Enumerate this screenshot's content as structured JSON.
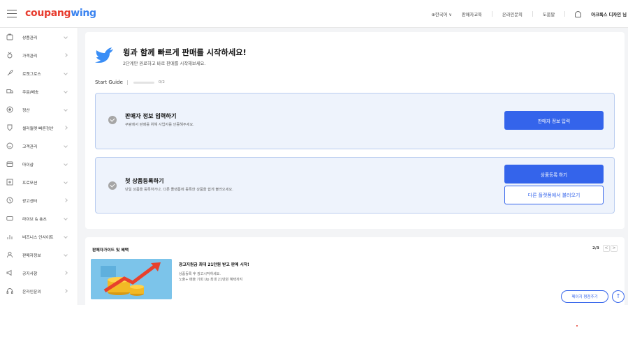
{
  "brand": {
    "part1": "coupang",
    "part2": "wing",
    "color1": "#e73c2f",
    "color2": "#3a83f0"
  },
  "topbar": {
    "language": "⊕한국어 ∨",
    "links": [
      "판매자교육",
      "온라인문의",
      "도움말"
    ],
    "user": "아크록스 디자인 님"
  },
  "sidebar": {
    "items": [
      {
        "label": "상품관리",
        "icon": "product-icon",
        "chevron": "down"
      },
      {
        "label": "가격관리",
        "icon": "price-icon",
        "chevron": "right"
      },
      {
        "label": "로켓그로스",
        "icon": "rocket-icon",
        "chevron": "down"
      },
      {
        "label": "주문/배송",
        "icon": "truck-icon",
        "chevron": "down"
      },
      {
        "label": "정산",
        "icon": "coin-icon",
        "chevron": "down"
      },
      {
        "label": "셀러월렛·빠른정산",
        "icon": "wallet-icon",
        "chevron": "right"
      },
      {
        "label": "고객관리",
        "icon": "customer-icon",
        "chevron": "down"
      },
      {
        "label": "마이샵",
        "icon": "shop-icon",
        "chevron": "down"
      },
      {
        "label": "프로모션",
        "icon": "promotion-icon",
        "chevron": "down"
      },
      {
        "label": "광고센터",
        "icon": "ad-icon",
        "chevron": "right"
      },
      {
        "label": "라이브 & 숏츠",
        "icon": "live-icon",
        "chevron": "down"
      },
      {
        "label": "비즈니스 인사이트",
        "icon": "chart-icon",
        "chevron": "down"
      },
      {
        "label": "판매자정보",
        "icon": "user-icon",
        "chevron": "down"
      },
      {
        "label": "공지사항",
        "icon": "megaphone-icon",
        "chevron": "right"
      },
      {
        "label": "온라인문의",
        "icon": "headset-icon",
        "chevron": "right"
      }
    ]
  },
  "welcome": {
    "title": "윙과 함께 빠르게 판매를 시작하세요!",
    "subtitle": "2단계만 완료하고 바로 판매를 시작해보세요.",
    "guide_label": "Start Guide",
    "progress_text": "0/2",
    "progress_value": 0
  },
  "steps": [
    {
      "title": "판매자 정보 입력하기",
      "desc": "쿠팡에서 판매를 위해 사업자를 인증해주세요.",
      "primary": "판매자 정보 입력"
    },
    {
      "title": "첫 상품등록하기",
      "desc": "단일 상품을 등록하거나, 다른 플랫폼에 등록한 상품을 쉽게 불러오세요.",
      "primary": "상품등록 하기",
      "secondary": "다른 플랫폼에서 불러오기"
    }
  ],
  "guide": {
    "title": "판매자가이드 및 혜택",
    "page": "2/3",
    "prev": "<",
    "next": ">",
    "ad_title": "광고지원금 최대 21만원 받고 판매 시작!",
    "ad_line1": "상품등록 후 광고시작하세요.",
    "ad_line2": "노출+ 매출 기회 Up 최대 21만원 혜택까지"
  },
  "floating": {
    "evaluate": "페이지 평점주기",
    "top": "↑"
  }
}
